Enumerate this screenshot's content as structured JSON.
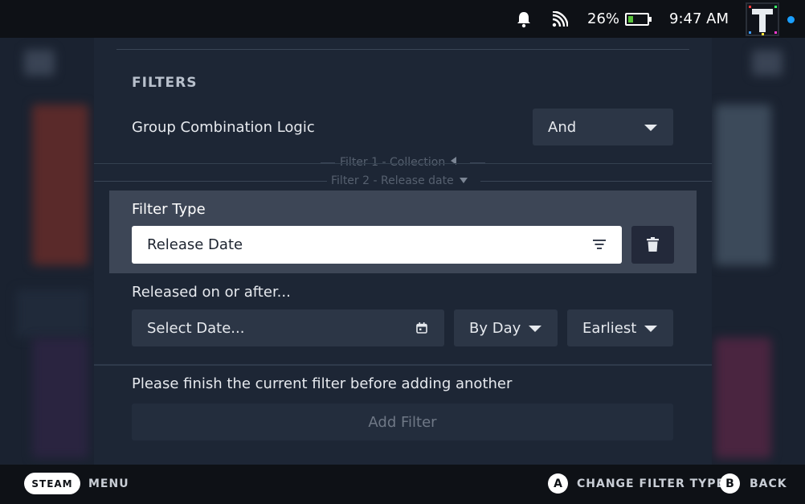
{
  "status_bar": {
    "battery_percent": "26%",
    "battery_level": 0.26,
    "time": "9:47 AM",
    "icons": [
      "bell-icon",
      "broadcast-icon",
      "battery-icon"
    ]
  },
  "filters": {
    "section_title": "FILTERS",
    "group_logic_label": "Group Combination Logic",
    "group_logic_value": "And",
    "filter1_label": "Filter 1 - Collection",
    "filter2_label": "Filter 2 - Release date",
    "filter_type_label": "Filter Type",
    "filter_type_value": "Release Date",
    "released_label": "Released on or after...",
    "date_placeholder": "Select Date...",
    "granularity_value": "By Day",
    "order_value": "Earliest",
    "hint": "Please finish the current filter before adding another",
    "add_filter_label": "Add Filter"
  },
  "bottom_bar": {
    "steam_label": "STEAM",
    "menu_label": "MENU",
    "a_button": "A",
    "a_label": "CHANGE FILTER TYPE",
    "b_button": "B",
    "b_label": "BACK"
  },
  "colors": {
    "accent": "#1a9fff",
    "panel": "#1d2635",
    "selected_row": "#3d4656",
    "battery_green": "#59c33a"
  }
}
